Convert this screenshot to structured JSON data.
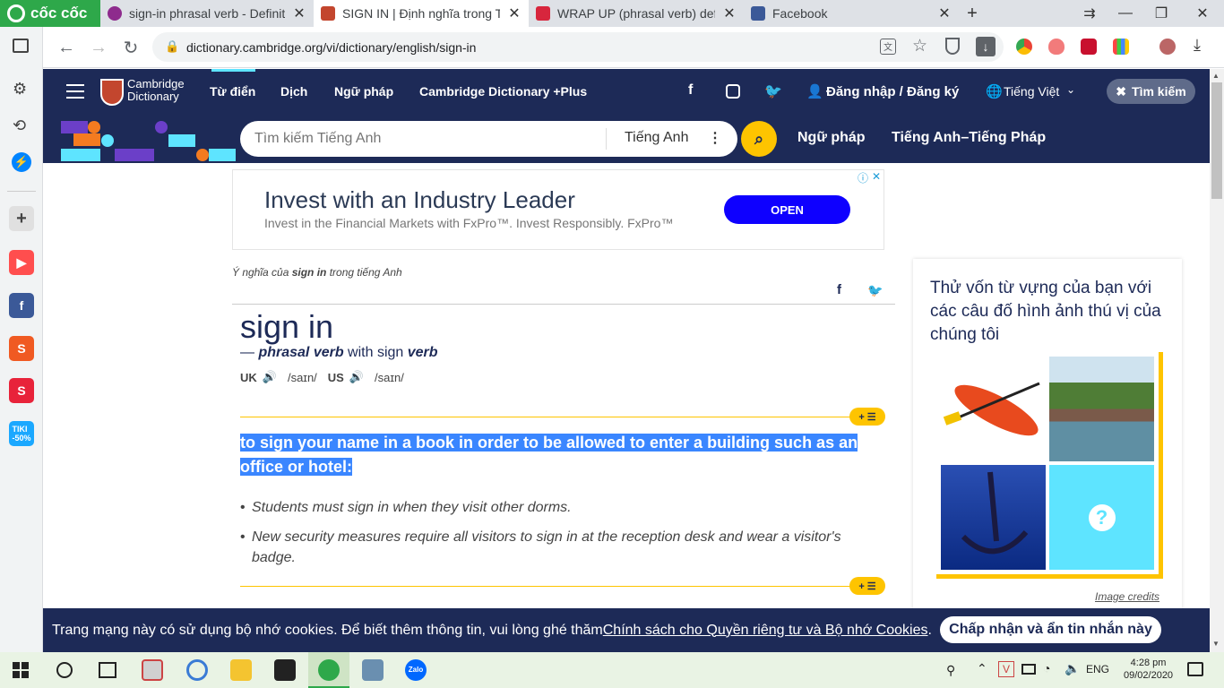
{
  "browser": {
    "logo_text": "cốc cốc",
    "tabs": [
      {
        "title": "sign-in phrasal verb - Definiti",
        "fav_color": "#8e2b8d",
        "active": false
      },
      {
        "title": "SIGN IN | Định nghĩa trong Từ",
        "fav_color": "#c3462e",
        "active": true
      },
      {
        "title": "WRAP UP (phrasal verb) defin",
        "fav_color": "#d7263d",
        "active": false
      },
      {
        "title": "Facebook",
        "fav_color": "#3b5998",
        "active": false
      }
    ],
    "url": "dictionary.cambridge.org/vi/dictionary/english/sign-in"
  },
  "site": {
    "logo_line1": "Cambridge",
    "logo_line2": "Dictionary",
    "nav": [
      "Từ điển",
      "Dịch",
      "Ngữ pháp",
      "Cambridge Dictionary +Plus"
    ],
    "login": "Đăng nhập / Đăng ký",
    "language": "Tiếng Việt",
    "search_toggle": "Tìm kiếm",
    "search_placeholder": "Tìm kiếm Tiếng Anh",
    "search_lang": "Tiếng Anh",
    "sub_links": [
      "Ngữ pháp",
      "Tiếng Anh–Tiếng Pháp"
    ]
  },
  "ad": {
    "title": "Invest with an Industry Leader",
    "subtitle": "Invest in the Financial Markets with FxPro™. Invest Responsibly. FxPro™",
    "cta": "OPEN"
  },
  "entry": {
    "crumb_prefix": "Ý nghĩa của ",
    "crumb_word": "sign in",
    "crumb_suffix": " trong tiếng Anh",
    "headword": "sign in",
    "pos_dash": "— ",
    "pos": "phrasal verb",
    "pos_with": " with sign ",
    "pos_verb": "verb",
    "uk_label": "UK",
    "uk_ipa": "/saɪn/",
    "us_label": "US",
    "us_ipa": "/saɪn/",
    "plus_label": "+ ☰",
    "definition": "to sign your name in a book in order to be allowed to enter a building such as an office or hotel:",
    "examples": [
      "Students must sign in when they visit other dorms.",
      "New security measures require all visitors to sign in at the reception desk and wear a visitor's badge."
    ]
  },
  "quiz": {
    "title": "Thử vốn từ vựng của bạn với các câu đố hình ảnh thú vị của chúng tôi",
    "credits": "Image credits"
  },
  "cookie": {
    "text_before": "Trang mạng này có sử dụng bộ nhớ cookies. Để biết thêm thông tin, vui lòng ghé thăm ",
    "link": "Chính sách cho Quyền riêng tư và Bộ nhớ Cookies",
    "text_after": ".",
    "button": "Chấp nhận và ẩn tin nhắn này"
  },
  "taskbar": {
    "lang": "ENG",
    "time": "4:28 pm",
    "date": "09/02/2020"
  }
}
